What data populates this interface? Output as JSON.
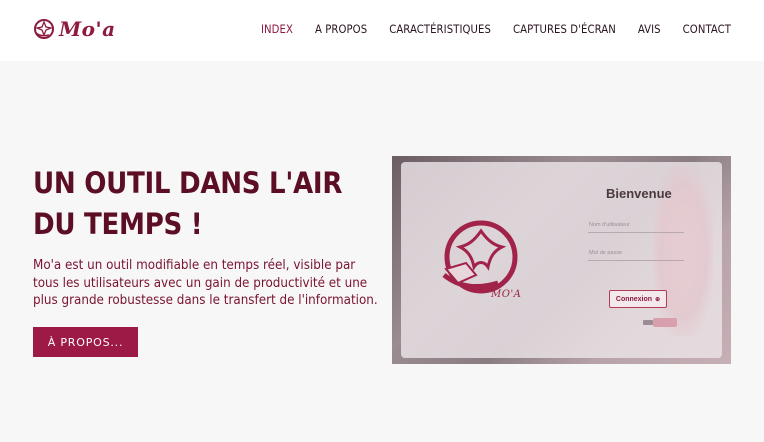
{
  "brand": {
    "name": "Mo'a",
    "logo_icon": "moa-flower-logo-icon"
  },
  "nav": {
    "items": [
      {
        "label": "INDEX",
        "active": true
      },
      {
        "label": "A PROPOS",
        "active": false
      },
      {
        "label": "CARACTÉRISTIQUES",
        "active": false
      },
      {
        "label": "CAPTURES D'ÉCRAN",
        "active": false
      },
      {
        "label": "AVIS",
        "active": false
      },
      {
        "label": "CONTACT",
        "active": false
      }
    ]
  },
  "hero": {
    "title": "UN OUTIL DANS L'AIR DU TEMPS !",
    "text": "Mo'a est un outil modifiable en temps réel, visible par tous les utilisateurs avec un gain de productivité et une plus grande robustesse dans le transfert de l'information.",
    "cta_label": "À PROPOS..."
  },
  "screenshot": {
    "title": "Bienvenue",
    "username_placeholder": "Nom d'utilisateur",
    "password_placeholder": "Mot de passe",
    "login_label": "Connexion",
    "logo_text": "MO'A"
  },
  "colors": {
    "accent": "#9c1a45",
    "title": "#5c0f24",
    "text": "#7a1430",
    "header_bg": "#ffffff",
    "page_bg": "#f7f7f8"
  }
}
